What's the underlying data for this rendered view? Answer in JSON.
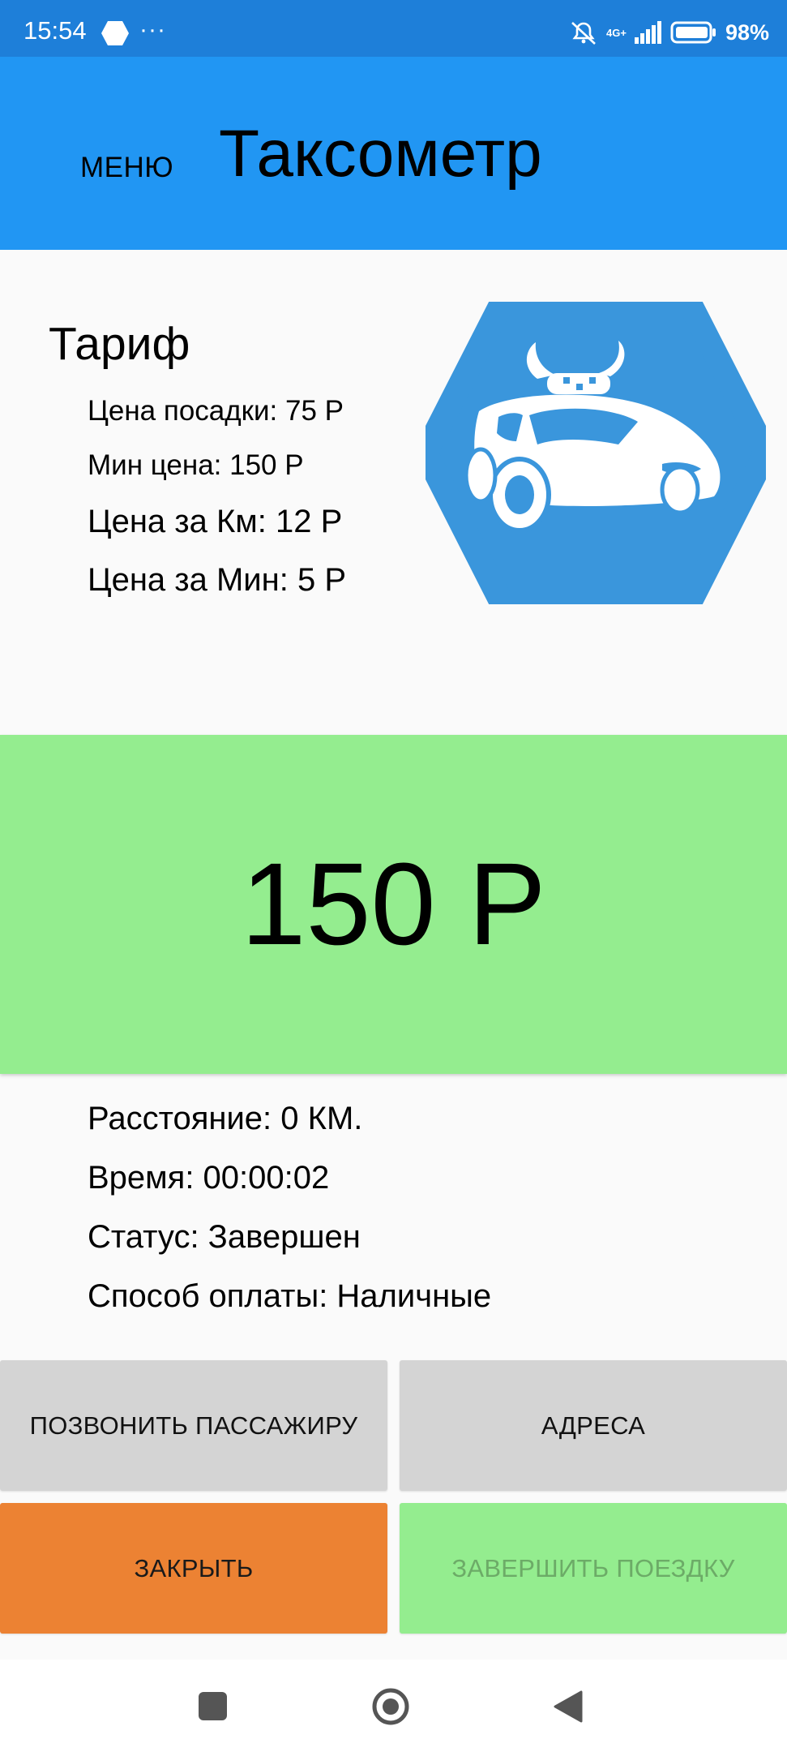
{
  "status_bar": {
    "time": "15:54",
    "dots": "···",
    "network_label": "4G+",
    "battery_percent": "98%"
  },
  "header": {
    "menu_label": "МЕНЮ",
    "title": "Таксометр"
  },
  "tariff": {
    "title": "Тариф",
    "boarding_price": "Цена посадки: 75 Р",
    "min_price": "Мин цена: 150 Р",
    "price_per_km": "Цена за Км: 12 Р",
    "price_per_min": "Цена за Мин: 5 Р"
  },
  "fare": {
    "amount": "150 Р"
  },
  "trip": {
    "distance": "Расстояние: 0 КМ.",
    "time": "Время: 00:00:02",
    "status": "Статус: Завершен",
    "payment": "Способ оплаты: Наличные"
  },
  "actions": {
    "call_passenger": "ПОЗВОНИТЬ ПАССАЖИРУ",
    "addresses": "АДРЕСА",
    "close": "ЗАКРЫТЬ",
    "finish_trip": "ЗАВЕРШИТЬ ПОЕЗДКУ"
  },
  "colors": {
    "status_bar": "#1e7fd9",
    "app_bar": "#2196f3",
    "fare_panel": "#94ed8f",
    "close_button": "#ec8233",
    "secondary_button": "#d4d4d4",
    "logo_blue": "#3a96dc"
  },
  "icons": {
    "logo": "taxi-car-logo-icon",
    "nav_recents": "square-icon",
    "nav_home": "circle-icon",
    "nav_back": "triangle-back-icon"
  }
}
